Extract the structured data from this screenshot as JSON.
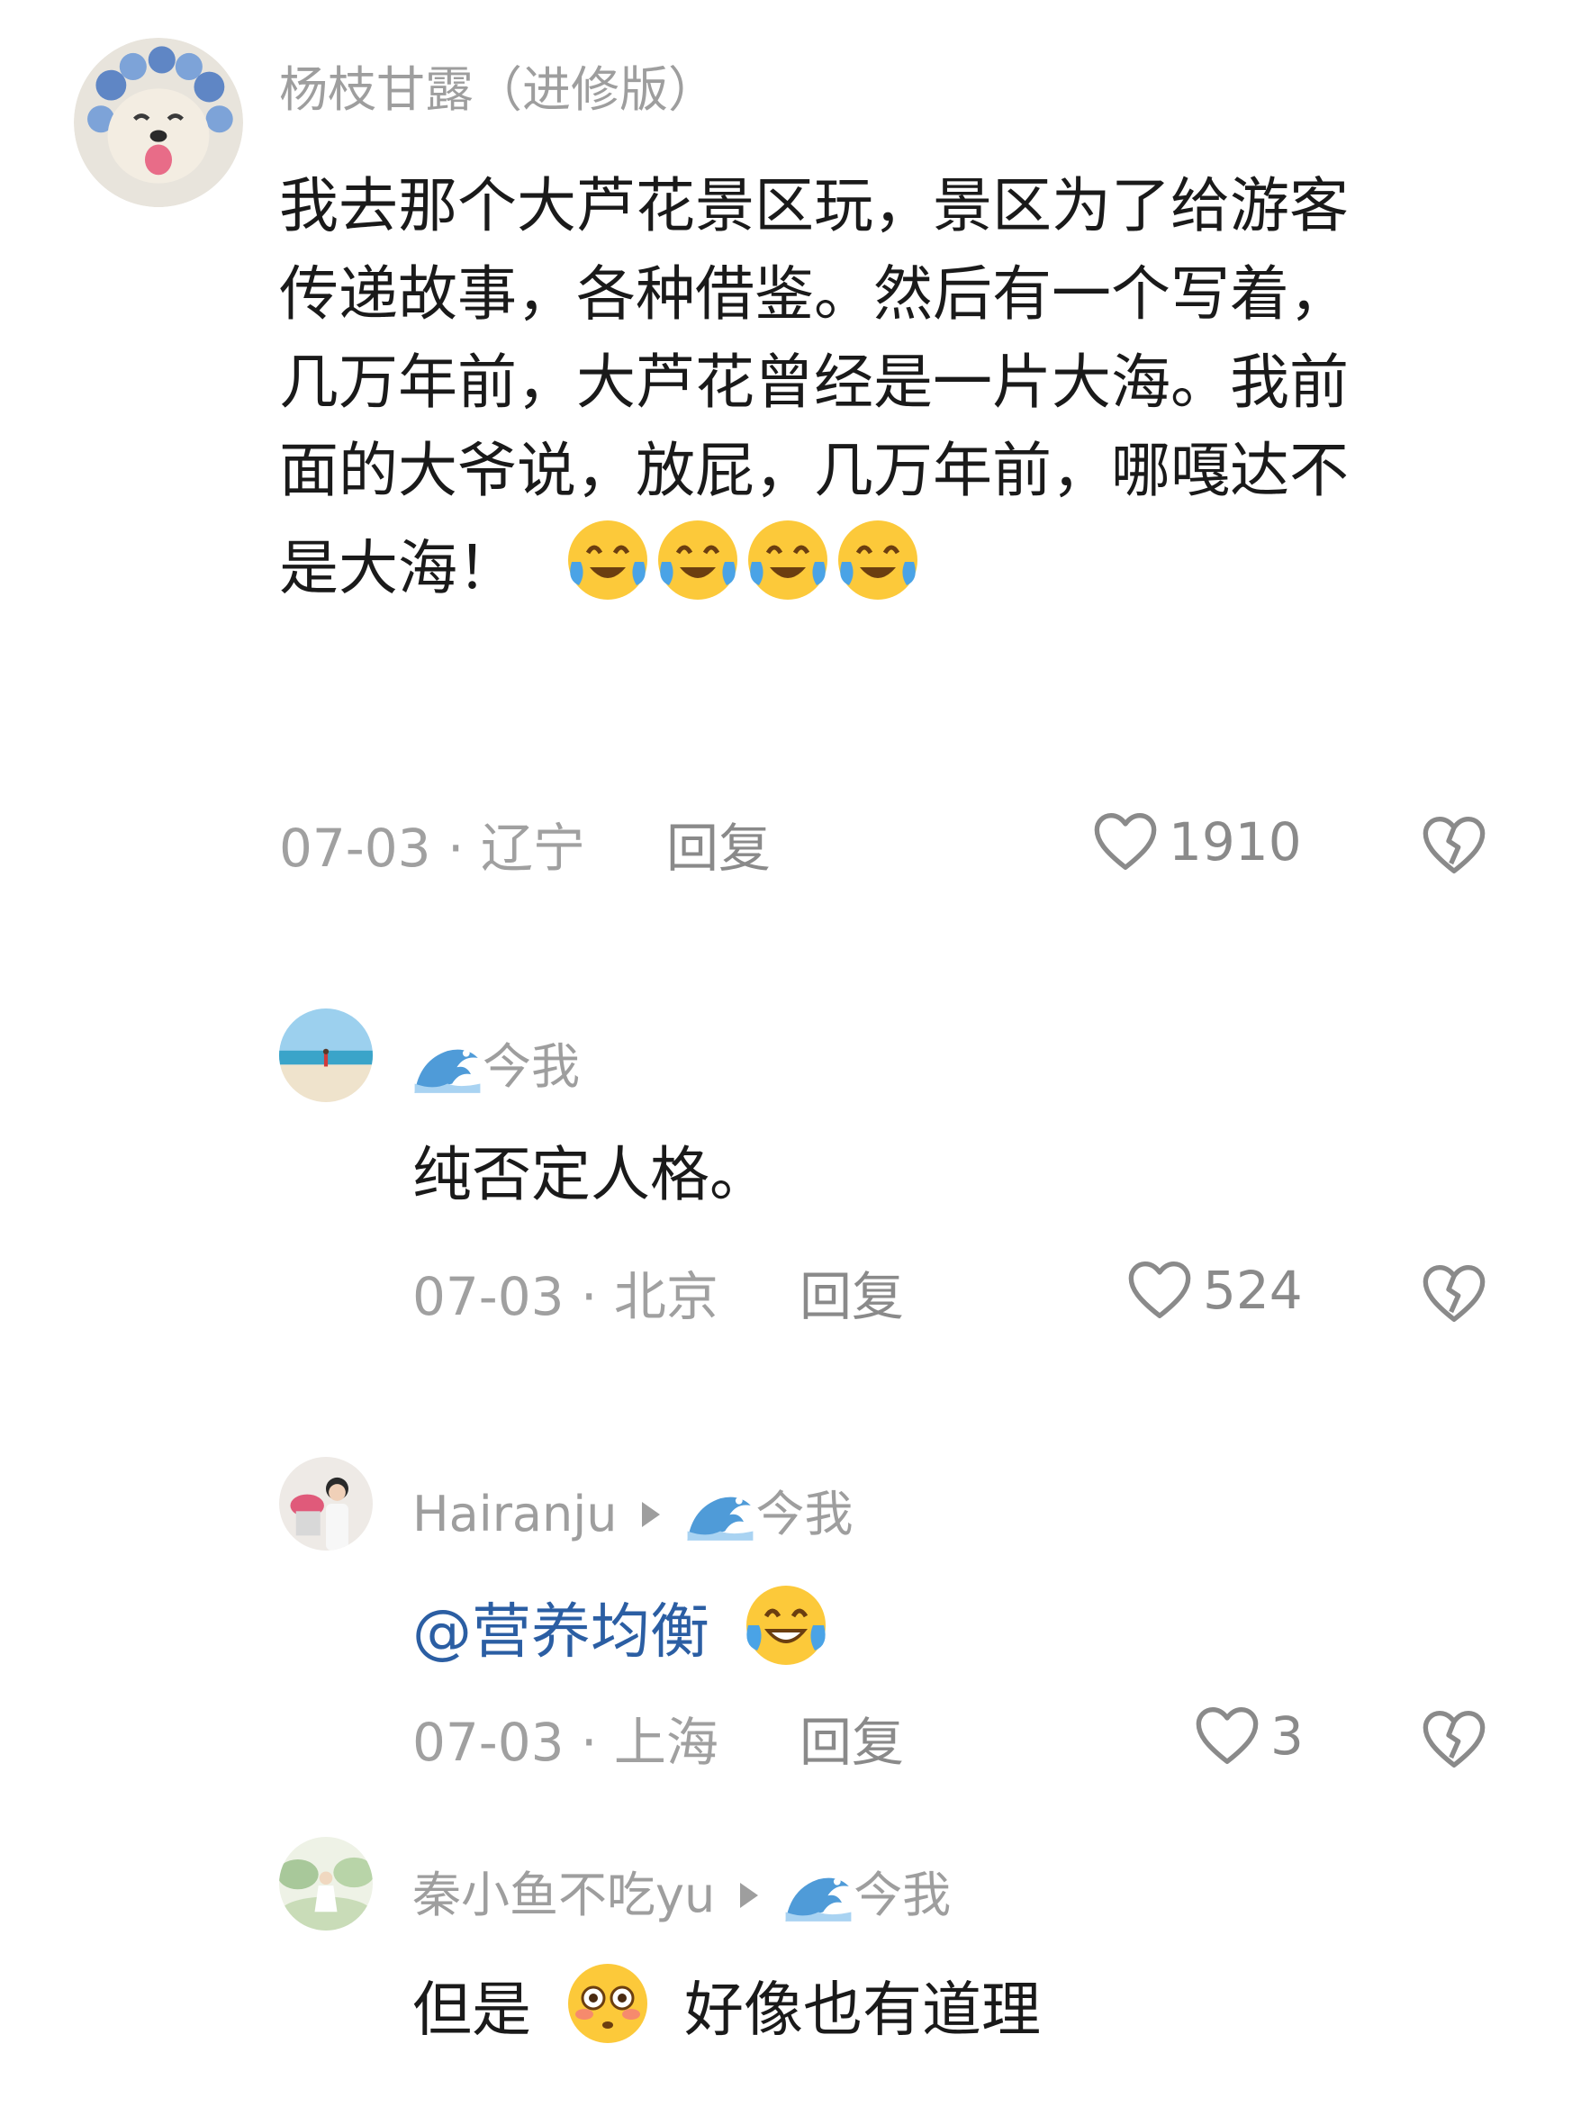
{
  "comments": [
    {
      "username": "杨枝甘露（进修版）",
      "lines": [
        "我去那个大芦花景区玩，景区为了给游客",
        "传递故事，各种借鉴。然后有一个写着，",
        "几万年前，大芦花曾经是一片大海。我前",
        "面的大爷说，放屁，几万年前，哪嘎达不",
        "是大海！"
      ],
      "emoji_after_text": "crying-laughing-emoji x4",
      "date_location": "07-03 · 辽宁",
      "reply_label": "回复",
      "like_count": "1910",
      "avatar_icon": "dog-avatar"
    },
    {
      "username_suffix": "今我",
      "text": "纯否定人格。",
      "date_location": "07-03 · 北京",
      "reply_label": "回复",
      "like_count": "524",
      "avatar_icon": "beach-avatar",
      "name_icon": "wave-icon"
    },
    {
      "username": "Hairanju",
      "reply_to": "今我",
      "mention": "@营养均衡",
      "emoji": "crying-laughing-emoji",
      "date_location": "07-03 · 上海",
      "reply_label": "回复",
      "like_count": "3",
      "avatar_icon": "person-avatar",
      "name_icon": "wave-icon"
    },
    {
      "username": "秦小鱼不吃yu",
      "reply_to": "今我",
      "text_before": "但是",
      "text_after": "好像也有道理",
      "emoji": "flushed-emoji",
      "avatar_icon": "garden-avatar",
      "name_icon": "wave-icon"
    }
  ],
  "colors": {
    "username": "#9e9e9e",
    "meta": "#a0a0a0",
    "body": "#1a1a1a",
    "mention": "#2b5ea3"
  }
}
